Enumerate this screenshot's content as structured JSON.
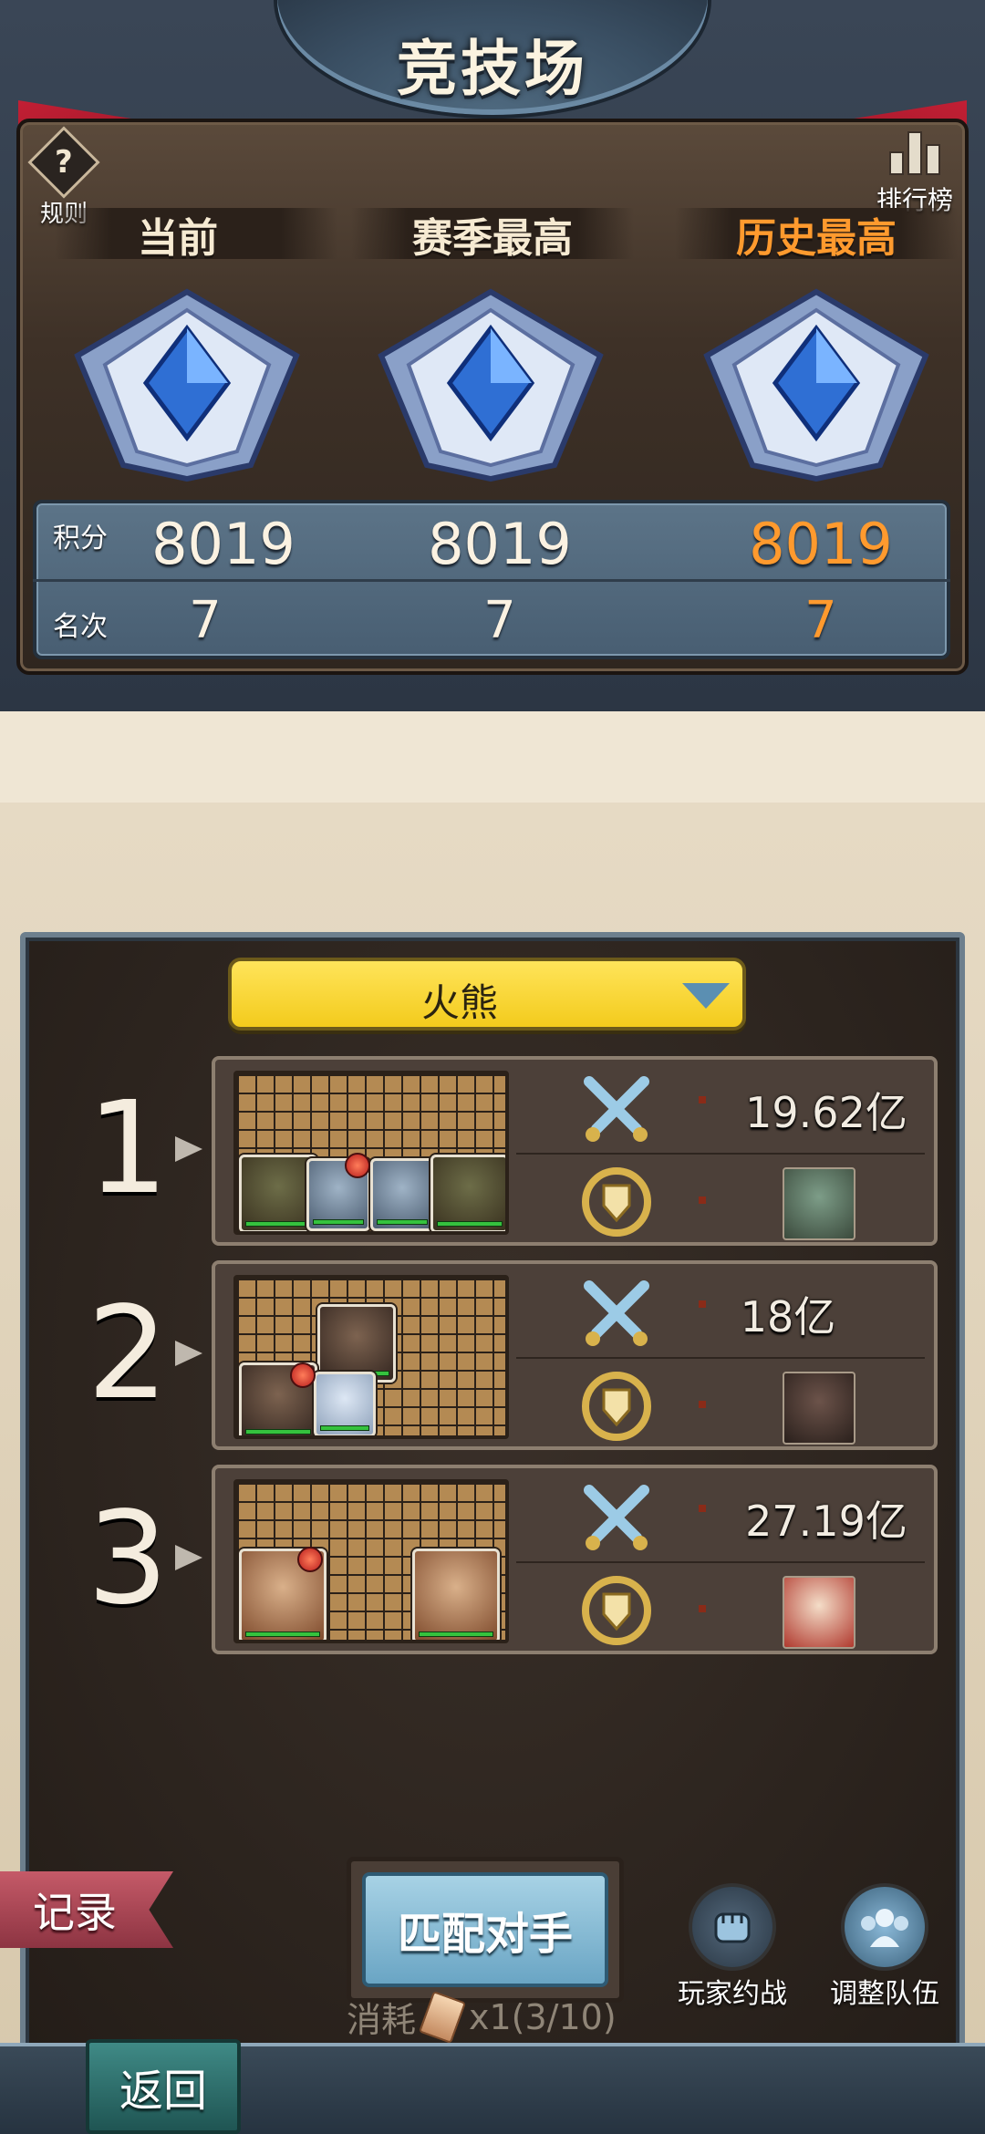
{
  "header": {
    "title": "竞技场",
    "rules_label": "规则",
    "ranking_label": "排行榜"
  },
  "columns": {
    "current": "当前",
    "season_best": "赛季最高",
    "history_best": "历史最高"
  },
  "stats": {
    "score_label": "积分",
    "rank_label": "名次",
    "current": {
      "score": "8019",
      "rank": "7"
    },
    "season_best": {
      "score": "8019",
      "rank": "7"
    },
    "history_best": {
      "score": "8019",
      "rank": "7"
    }
  },
  "team_select": {
    "selected": "火熊"
  },
  "teams": [
    {
      "index": "1",
      "power": "19.62亿"
    },
    {
      "index": "2",
      "power": "18亿"
    },
    {
      "index": "3",
      "power": "27.19亿"
    }
  ],
  "controls": {
    "record": "记录",
    "match": "匹配对手",
    "cost_label": "消耗",
    "cost_value": "x1(3/10)",
    "player_battle": "玩家约战",
    "adjust_team": "调整队伍",
    "back": "返回"
  },
  "colors": {
    "history_accent": "#ff9a2e",
    "dropdown_yellow": "#f3cb1c",
    "match_button_blue": "#6aa5c4"
  }
}
